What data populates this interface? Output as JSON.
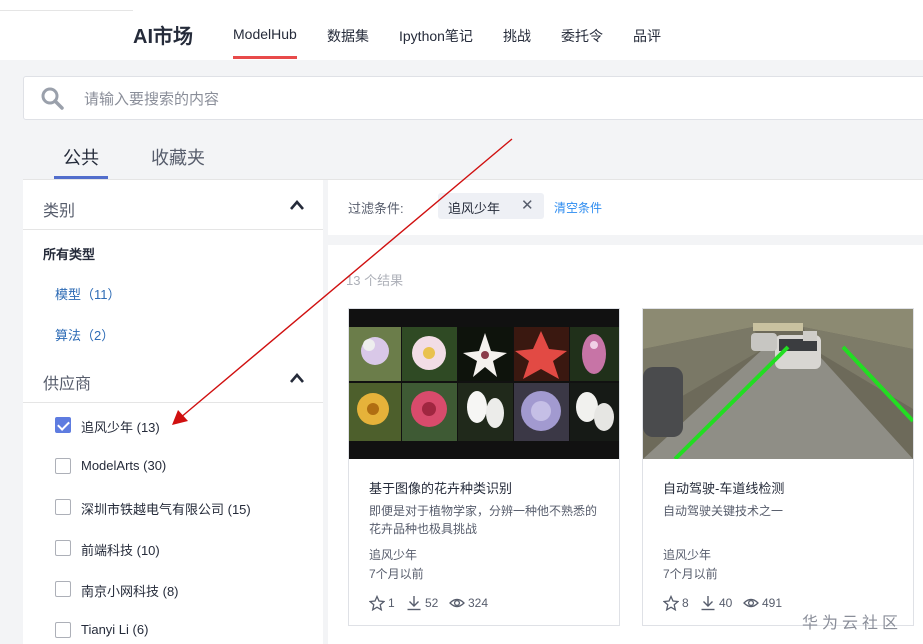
{
  "header": {
    "brand": "AI市场",
    "nav": [
      "ModelHub",
      "数据集",
      "Ipython笔记",
      "挑战",
      "委托令",
      "品评"
    ]
  },
  "search": {
    "placeholder": "请输入要搜索的内容"
  },
  "tabs": [
    "公共",
    "收藏夹"
  ],
  "sidebar": {
    "category_title": "类别",
    "all_types": "所有类型",
    "categories": [
      "模型（11）",
      "算法（2）"
    ],
    "vendor_title": "供应商",
    "vendors": [
      {
        "label": "追风少年 (13)",
        "checked": true
      },
      {
        "label": "ModelArts (30)",
        "checked": false
      },
      {
        "label": "深圳市铁越电气有限公司 (15)",
        "checked": false
      },
      {
        "label": "前端科技 (10)",
        "checked": false
      },
      {
        "label": "南京小网科技 (8)",
        "checked": false
      },
      {
        "label": "Tianyi Li (6)",
        "checked": false
      }
    ]
  },
  "filter": {
    "label": "过滤条件:",
    "chip": "追风少年",
    "chip_close": "✕",
    "clear": "清空条件"
  },
  "results": {
    "count_text": "13 个结果",
    "cards": [
      {
        "title": "基于图像的花卉种类识别",
        "desc": "即便是对于植物学家，分辨一种他不熟悉的花卉品种也极具挑战",
        "author": "追风少年",
        "date": "7个月以前",
        "stars": "1",
        "downloads": "52",
        "views": "324"
      },
      {
        "title": "自动驾驶-车道线检测",
        "desc": "自动驾驶关键技术之一",
        "author": "追风少年",
        "date": "7个月以前",
        "stars": "8",
        "downloads": "40",
        "views": "491"
      }
    ]
  },
  "watermark": "华为云社区",
  "colors": {
    "accent_red": "#e84a4a",
    "tab_blue": "#526ecc",
    "link_blue": "#2d6bb5",
    "checkbox_blue": "#5e7ce0",
    "annotation_arrow": "#d01010",
    "lane_green": "#22dd22"
  }
}
